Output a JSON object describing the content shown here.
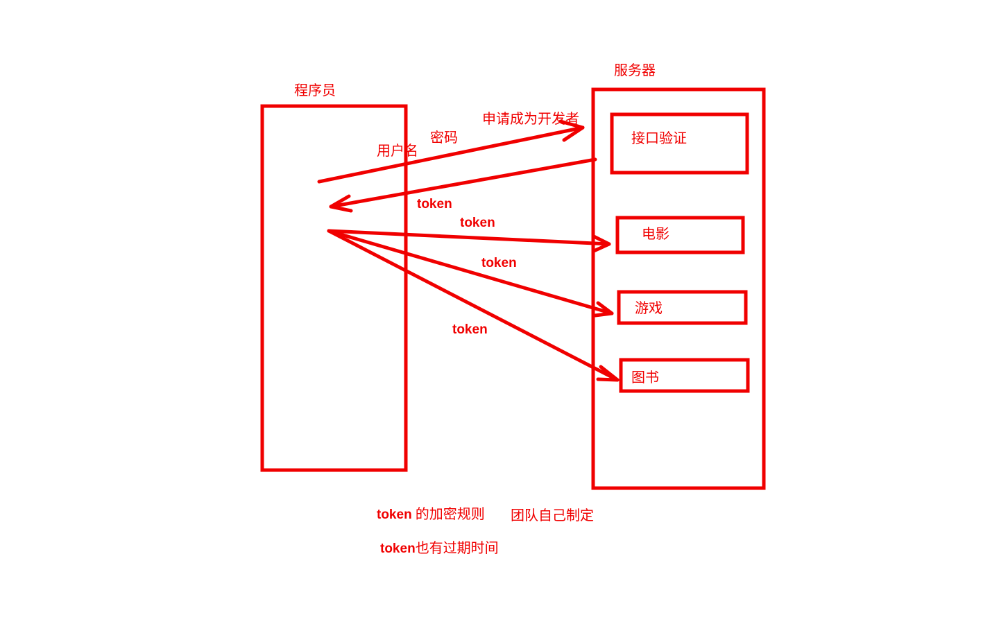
{
  "colors": {
    "stroke": "#f00000",
    "background": "#ffffff"
  },
  "programmer": {
    "title": "程序员"
  },
  "server": {
    "title": "服务器",
    "modules": {
      "auth": "接口验证",
      "movie": "电影",
      "game": "游戏",
      "book": "图书"
    }
  },
  "flows": {
    "apply": "申请成为开发者",
    "username": "用户名",
    "password": "密码",
    "token_return": "token",
    "token_movie": "token",
    "token_game": "token",
    "token_book": "token"
  },
  "notes": {
    "rule_prefix": "token",
    "rule_text": "的加密规则",
    "rule_team": "团队自己制定",
    "expiry_prefix": "token",
    "expiry_text": "也有过期时间"
  }
}
